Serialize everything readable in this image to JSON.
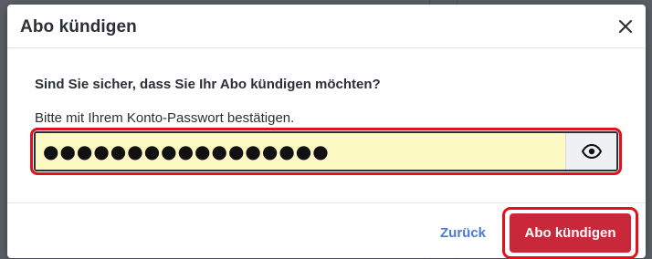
{
  "dialog": {
    "title": "Abo kündigen",
    "close_icon": "close-icon"
  },
  "body": {
    "question": "Sind Sie sicher, dass Sie Ihr Abo kündigen möchten?",
    "hint": "Bitte mit Ihrem Konto-Passwort bestätigen.",
    "password": {
      "value": "●●●●●●●●●●●●●●●●●",
      "visibility_icon": "eye-icon"
    }
  },
  "footer": {
    "back_label": "Zurück",
    "confirm_label": "Abo kündigen"
  },
  "colors": {
    "danger": "#c8283a",
    "link": "#4d79d6",
    "highlight": "#e0101c",
    "input_bg": "#fcf9c3"
  }
}
